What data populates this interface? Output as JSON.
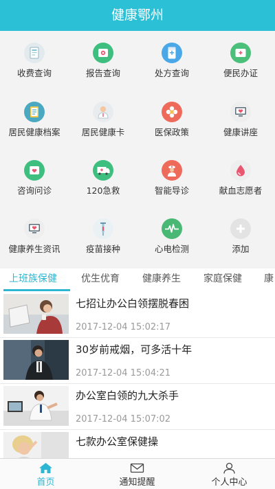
{
  "header": {
    "title": "健康鄂州"
  },
  "grid": [
    {
      "label": "收费查询",
      "icon": "receipt-icon",
      "color": "#e8eef2"
    },
    {
      "label": "报告查询",
      "icon": "report-icon",
      "color": "#3fbf7f"
    },
    {
      "label": "处方查询",
      "icon": "prescription-icon",
      "color": "#4aa8e8"
    },
    {
      "label": "便民办证",
      "icon": "certificate-icon",
      "color": "#4cbf7a"
    },
    {
      "label": "居民健康档案",
      "icon": "health-record-icon",
      "color": "#4aa8c0"
    },
    {
      "label": "居民健康卡",
      "icon": "doctor-icon",
      "color": "#e9ecef"
    },
    {
      "label": "医保政策",
      "icon": "insurance-flower-icon",
      "color": "#ee6a5a"
    },
    {
      "label": "健康讲座",
      "icon": "lecture-monitor-icon",
      "color": "#f1f1f1"
    },
    {
      "label": "咨询问诊",
      "icon": "consult-icon",
      "color": "#3fbf7f"
    },
    {
      "label": "120急救",
      "icon": "ambulance-icon",
      "color": "#3fbf7f"
    },
    {
      "label": "智能导诊",
      "icon": "nurse-icon",
      "color": "#ee6a5a"
    },
    {
      "label": "献血志愿者",
      "icon": "blood-drop-icon",
      "color": "#eeeeee"
    },
    {
      "label": "健康养生资讯",
      "icon": "wellness-monitor-icon",
      "color": "#f1f1f1"
    },
    {
      "label": "疫苗接种",
      "icon": "vaccine-icon",
      "color": "#eef3f5"
    },
    {
      "label": "心电检测",
      "icon": "ecg-icon",
      "color": "#49b874"
    },
    {
      "label": "添加",
      "icon": "add-icon",
      "color": "#e8e8e8"
    }
  ],
  "tabs": [
    "上班族保健",
    "优生优育",
    "健康养生",
    "家庭保健",
    "康"
  ],
  "articles": [
    {
      "title": "七招让办公白领摆脱春困",
      "time": "2017-12-04 15:02:17"
    },
    {
      "title": "30岁前戒烟，可多活十年",
      "time": "2017-12-04 15:04:21"
    },
    {
      "title": "办公室白领的九大杀手",
      "time": "2017-12-04 15:07:02"
    },
    {
      "title": "七款办公室保健操",
      "time": ""
    }
  ],
  "nav": {
    "home": {
      "label": "首页",
      "icon": "home-icon"
    },
    "notify": {
      "label": "通知提醒",
      "icon": "mail-icon"
    },
    "profile": {
      "label": "个人中心",
      "icon": "user-icon"
    }
  },
  "colors": {
    "accent": "#2cb6d2",
    "header": "#2cc0d6"
  }
}
